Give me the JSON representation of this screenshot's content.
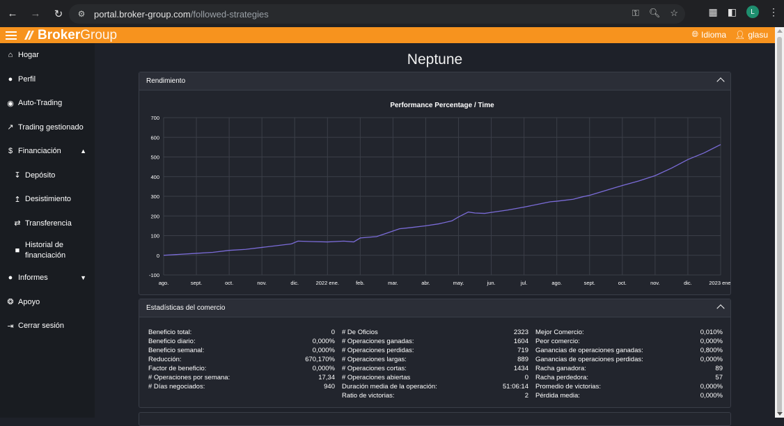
{
  "browser": {
    "url_domain": "portal.broker-group.com",
    "url_path": "/followed-strategies",
    "profile_initial": "L"
  },
  "header": {
    "logo_bold": "Broker",
    "logo_light": "Group",
    "language_label": "Idioma",
    "user_label": "glasu",
    "accent_color": "#f7931e"
  },
  "sidebar": {
    "items": [
      {
        "label": "Hogar",
        "icon": "home-icon"
      },
      {
        "label": "Perfil",
        "icon": "user-icon"
      },
      {
        "label": "Auto-Trading",
        "icon": "robot-icon"
      },
      {
        "label": "Trading gestionado",
        "icon": "trending-icon"
      },
      {
        "label": "Financiación",
        "icon": "finance-icon"
      },
      {
        "label": "Depósito",
        "icon": "download-icon"
      },
      {
        "label": "Desistimiento",
        "icon": "upload-icon"
      },
      {
        "label": "Transferencia",
        "icon": "transfer-icon"
      },
      {
        "label": "Historial de financiación",
        "icon": "document-icon"
      },
      {
        "label": "Informes",
        "icon": "info-icon"
      },
      {
        "label": "Apoyo",
        "icon": "lifebuoy-icon"
      },
      {
        "label": "Cerrar sesión",
        "icon": "logout-icon"
      }
    ]
  },
  "main": {
    "title": "Neptune",
    "performance_header": "Rendimiento",
    "stats_header": "Estadísticas del comercio"
  },
  "chart_data": {
    "type": "line",
    "title": "Performance Percentage / Time",
    "xlabel": "",
    "ylabel": "",
    "ylim": [
      -100,
      700
    ],
    "y_ticks": [
      "700",
      "600",
      "500",
      "400",
      "300",
      "200",
      "100",
      "0",
      "-100"
    ],
    "x_ticks": [
      "ago.",
      "sept.",
      "oct.",
      "nov.",
      "dic.",
      "2022 ene.",
      "feb.",
      "mar.",
      "abr.",
      "may.",
      "jun.",
      "jul.",
      "ago.",
      "sept.",
      "oct.",
      "nov.",
      "dic.",
      "2023 ene."
    ],
    "grid": true,
    "line_color": "#7b6cd9",
    "series": [
      {
        "x": [
          0,
          1,
          1.5,
          2,
          2.5,
          3,
          3.5,
          3.9,
          4.1,
          4.5,
          5,
          5.5,
          5.8,
          6,
          6.5,
          6.8,
          7.2,
          7.5,
          8,
          8.4,
          8.8,
          9,
          9.3,
          9.5,
          9.8,
          10,
          10.5,
          11,
          11.5,
          11.8,
          12,
          12.5,
          12.8,
          13,
          13.3,
          13.6,
          13.9,
          14,
          14.5,
          15,
          15.5,
          16,
          16.5,
          17
        ],
        "y": [
          0,
          10,
          15,
          25,
          30,
          40,
          50,
          58,
          72,
          70,
          68,
          72,
          68,
          88,
          95,
          112,
          135,
          140,
          150,
          160,
          175,
          195,
          220,
          215,
          213,
          218,
          230,
          245,
          262,
          272,
          275,
          285,
          298,
          305,
          320,
          335,
          350,
          355,
          378,
          405,
          443,
          487,
          521,
          563
        ]
      }
    ]
  },
  "stats": {
    "col1": [
      {
        "label": "Beneficio total:",
        "value": "0"
      },
      {
        "label": "Beneficio diario:",
        "value": "0,000%"
      },
      {
        "label": "Beneficio semanal:",
        "value": "0,000%"
      },
      {
        "label": "Reducción:",
        "value": "670,170%"
      },
      {
        "label": "Factor de beneficio:",
        "value": "0,000%"
      },
      {
        "label": "# Operaciones por semana:",
        "value": "17,34"
      },
      {
        "label": "# Días negociados:",
        "value": "940"
      }
    ],
    "col2": [
      {
        "label": "# De Oficios",
        "value": "2323"
      },
      {
        "label": "# Operaciones ganadas:",
        "value": "1604"
      },
      {
        "label": "# Operaciones perdidas:",
        "value": "719"
      },
      {
        "label": "# Operaciones largas:",
        "value": "889"
      },
      {
        "label": "# Operaciones cortas:",
        "value": "1434"
      },
      {
        "label": "# Operaciones abiertas",
        "value": "0"
      },
      {
        "label": "Duración media de la operación:",
        "value": "51:06:14"
      },
      {
        "label": "Ratio de victorias:",
        "value": "2"
      }
    ],
    "col3": [
      {
        "label": "Mejor Comercio:",
        "value": "0,010%"
      },
      {
        "label": "Peor comercio:",
        "value": "0,000%"
      },
      {
        "label": "Ganancias de operaciones ganadas:",
        "value": "0,800%"
      },
      {
        "label": "Ganancias de operaciones perdidas:",
        "value": "0,000%"
      },
      {
        "label": "Racha ganadora:",
        "value": "89"
      },
      {
        "label": "Racha perdedora:",
        "value": "57"
      },
      {
        "label": "Promedio de victorias:",
        "value": "0,000%"
      },
      {
        "label": "Pérdida media:",
        "value": "0,000%"
      }
    ]
  }
}
